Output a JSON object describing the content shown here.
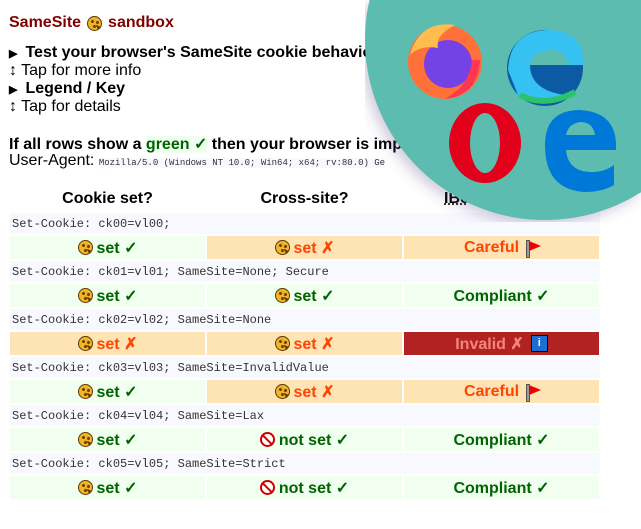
{
  "title": {
    "before": "SameSite",
    "after": "sandbox",
    "icon": "cookie-icon"
  },
  "details": [
    {
      "summary": "Test your browser's SameSite cookie behavio",
      "hint": "Tap for more info"
    },
    {
      "summary": "Legend / Key",
      "hint": "Tap for details"
    }
  ],
  "hint_icon": "↕",
  "intro": {
    "before": "If all rows show a ",
    "green": "green ✓",
    "after": " then your browser is imp"
  },
  "user_agent": {
    "label": "User-Agent:",
    "value": "Mozilla/5.0 (Windows NT 10.0; Win64; x64; rv:80.0) Ge"
  },
  "headers": [
    "Cookie set?",
    "Cross-site?",
    "IBc"
  ],
  "colors": {
    "ok_bg": "#f0fff0",
    "ok_text": "#006400",
    "warn_bg": "#fee3b5",
    "warn_text": "#ff4500",
    "bad_bg": "#b22222",
    "title": "#800000",
    "overlay": "#5dbcb0"
  },
  "rows": [
    {
      "code": "Set-Cookie: ck00=vl00;",
      "cells": [
        {
          "s": "ok",
          "icon": "cookie",
          "text": "set ✓"
        },
        {
          "s": "warn",
          "icon": "cookie",
          "text": "set ✗"
        },
        {
          "s": "warn",
          "text": "Careful",
          "suffix": "flag"
        }
      ]
    },
    {
      "code": "Set-Cookie: ck01=vl01; SameSite=None; Secure",
      "cells": [
        {
          "s": "ok",
          "icon": "cookie",
          "text": "set ✓"
        },
        {
          "s": "ok",
          "icon": "cookie",
          "text": "set ✓"
        },
        {
          "s": "ok",
          "text": "Compliant ✓"
        }
      ]
    },
    {
      "code": "Set-Cookie: ck02=vl02; SameSite=None",
      "cells": [
        {
          "s": "warn",
          "icon": "cookie",
          "text": "set ✗"
        },
        {
          "s": "warn",
          "icon": "cookie",
          "text": "set ✗"
        },
        {
          "s": "bad",
          "text": "Invalid ✗",
          "suffix": "info"
        }
      ]
    },
    {
      "code": "Set-Cookie: ck03=vl03; SameSite=InvalidValue",
      "cells": [
        {
          "s": "ok",
          "icon": "cookie",
          "text": "set ✓"
        },
        {
          "s": "warn",
          "icon": "cookie",
          "text": "set ✗"
        },
        {
          "s": "warn",
          "text": "Careful",
          "suffix": "flag"
        }
      ]
    },
    {
      "code": "Set-Cookie: ck04=vl04; SameSite=Lax",
      "cells": [
        {
          "s": "ok",
          "icon": "cookie",
          "text": "set ✓"
        },
        {
          "s": "ok",
          "icon": "noentry",
          "text": "not set ✓"
        },
        {
          "s": "ok",
          "text": "Compliant ✓"
        }
      ]
    },
    {
      "code": "Set-Cookie: ck05=vl05; SameSite=Strict",
      "cells": [
        {
          "s": "ok",
          "icon": "cookie",
          "text": "set ✓"
        },
        {
          "s": "ok",
          "icon": "noentry",
          "text": "not set ✓"
        },
        {
          "s": "ok",
          "text": "Compliant ✓"
        }
      ]
    }
  ],
  "info_label": "i",
  "browser_logos": [
    "firefox-logo",
    "edge-logo",
    "opera-logo",
    "edge-legacy-logo"
  ]
}
